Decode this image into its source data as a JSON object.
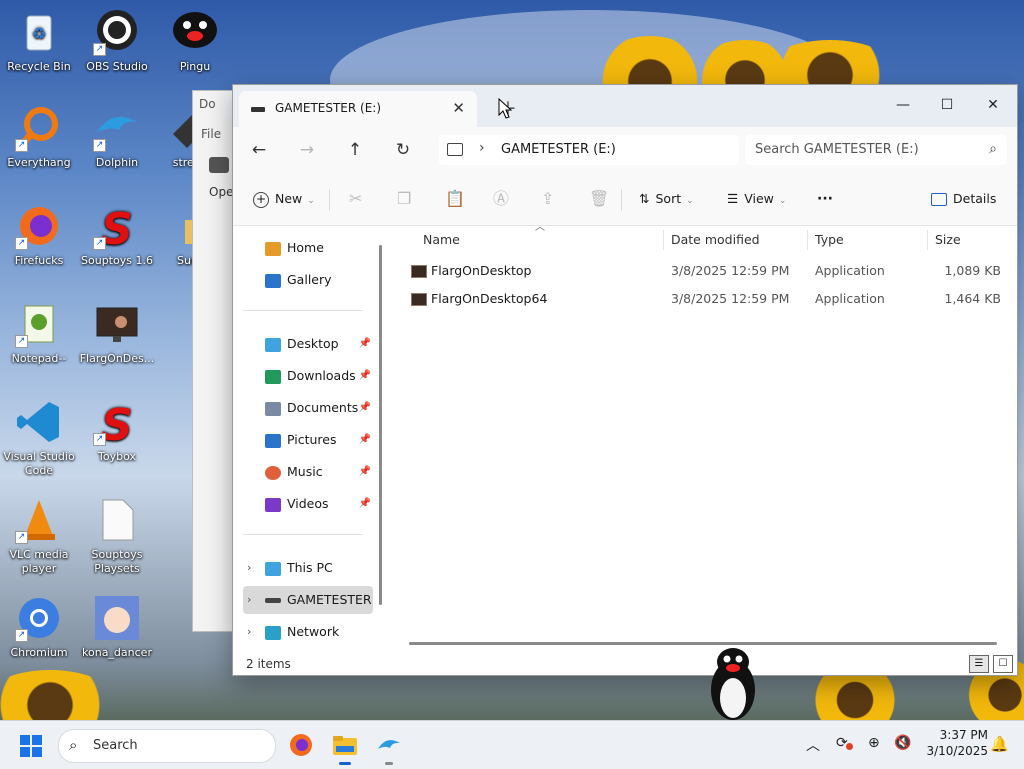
{
  "desktop": {
    "icons": [
      {
        "label": "Recycle Bin"
      },
      {
        "label": "OBS Studio"
      },
      {
        "label": "Pingu"
      },
      {
        "label": "Everythang"
      },
      {
        "label": "Dolphin"
      },
      {
        "label": "stress"
      },
      {
        "label": "Firefucks"
      },
      {
        "label": "Souptoys 1.6"
      },
      {
        "label": "Suni"
      },
      {
        "label": "Notepad--"
      },
      {
        "label": "FlargOnDes..."
      },
      {
        "label": "Visual Studio Code"
      },
      {
        "label": "Toybox"
      },
      {
        "label": "VLC media player"
      },
      {
        "label": "Souptoys Playsets"
      },
      {
        "label": "Chromium"
      },
      {
        "label": "kona_dancer"
      }
    ],
    "background_window": {
      "title": "Do",
      "menu": "File",
      "button": "Ope"
    }
  },
  "explorer": {
    "tab_title": "GAMETESTER (E:)",
    "window_controls": {
      "minimize": "—",
      "maximize": "☐",
      "close": "✕"
    },
    "address": {
      "path": "GAMETESTER (E:)"
    },
    "search": {
      "placeholder": "Search GAMETESTER (E:)"
    },
    "toolbar": {
      "new_label": "New",
      "sort_label": "Sort",
      "view_label": "View",
      "more_label": "···",
      "details_label": "Details"
    },
    "nav": {
      "home": "Home",
      "gallery": "Gallery",
      "quick": [
        {
          "label": "Desktop"
        },
        {
          "label": "Downloads"
        },
        {
          "label": "Documents"
        },
        {
          "label": "Pictures"
        },
        {
          "label": "Music"
        },
        {
          "label": "Videos"
        }
      ],
      "this_pc": "This PC",
      "gametester": "GAMETESTER (E",
      "network": "Network"
    },
    "columns": {
      "name": "Name",
      "date": "Date modified",
      "type": "Type",
      "size": "Size"
    },
    "files": [
      {
        "name": "FlargOnDesktop",
        "date": "3/8/2025 12:59 PM",
        "type": "Application",
        "size": "1,089 KB"
      },
      {
        "name": "FlargOnDesktop64",
        "date": "3/8/2025 12:59 PM",
        "type": "Application",
        "size": "1,464 KB"
      }
    ],
    "status": "2 items"
  },
  "taskbar": {
    "search_label": "Search",
    "time": "3:37 PM",
    "date": "3/10/2025"
  }
}
